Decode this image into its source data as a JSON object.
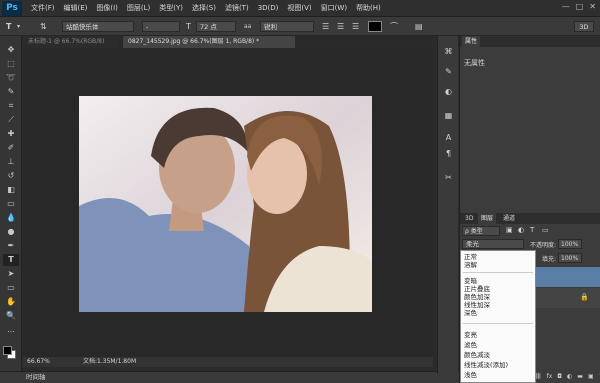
{
  "app": {
    "logo": "Ps"
  },
  "menu": [
    "文件(F)",
    "编辑(E)",
    "图像(I)",
    "图层(L)",
    "类型(Y)",
    "选择(S)",
    "滤镜(T)",
    "3D(D)",
    "视图(V)",
    "窗口(W)",
    "帮助(H)"
  ],
  "window_controls": {
    "minimize": "—",
    "restore": "□",
    "close": "✕"
  },
  "options": {
    "tool_glyph": "T",
    "font_family": "站酷快乐体",
    "font_style": "-",
    "font_size": "72 点",
    "antialias": "锐利",
    "mode_3d": "3D"
  },
  "tabs": [
    {
      "label": "未标题-1 @ 66.7%(RGB/8)",
      "active": false
    },
    {
      "label": "0827_145529.jpg @ 66.7%(图层 1, RGB/8) *",
      "active": true
    }
  ],
  "status": {
    "zoom": "66.67%",
    "doc": "文档:1.35M/1.80M"
  },
  "timeline": {
    "label": "时间轴"
  },
  "properties": {
    "tab": "属性",
    "empty_text": "无属性"
  },
  "layers": {
    "tabs": [
      "3D",
      "图层",
      "通道"
    ],
    "filter_label": "ρ 类型",
    "blend_mode": "柔光",
    "opacity_label": "不透明度:",
    "opacity_value": "100%",
    "fill_label": "填充:",
    "fill_value": "100%"
  },
  "blend_modes": {
    "group1": [
      "正常",
      "溶解"
    ],
    "group2": [
      "变暗",
      "正片叠底",
      "颜色加深",
      "线性加深",
      "深色"
    ],
    "group3": [
      "变亮",
      "滤色",
      "颜色减淡",
      "线性减淡(添加)",
      "浅色"
    ]
  },
  "colors": {
    "bg": "#2b2b2b",
    "panel": "#3c3c3c",
    "accent": "#4fb3f0",
    "foreground_color": "#000000",
    "background_color": "#ffffff",
    "selected_layer": "#5a7ea6"
  }
}
